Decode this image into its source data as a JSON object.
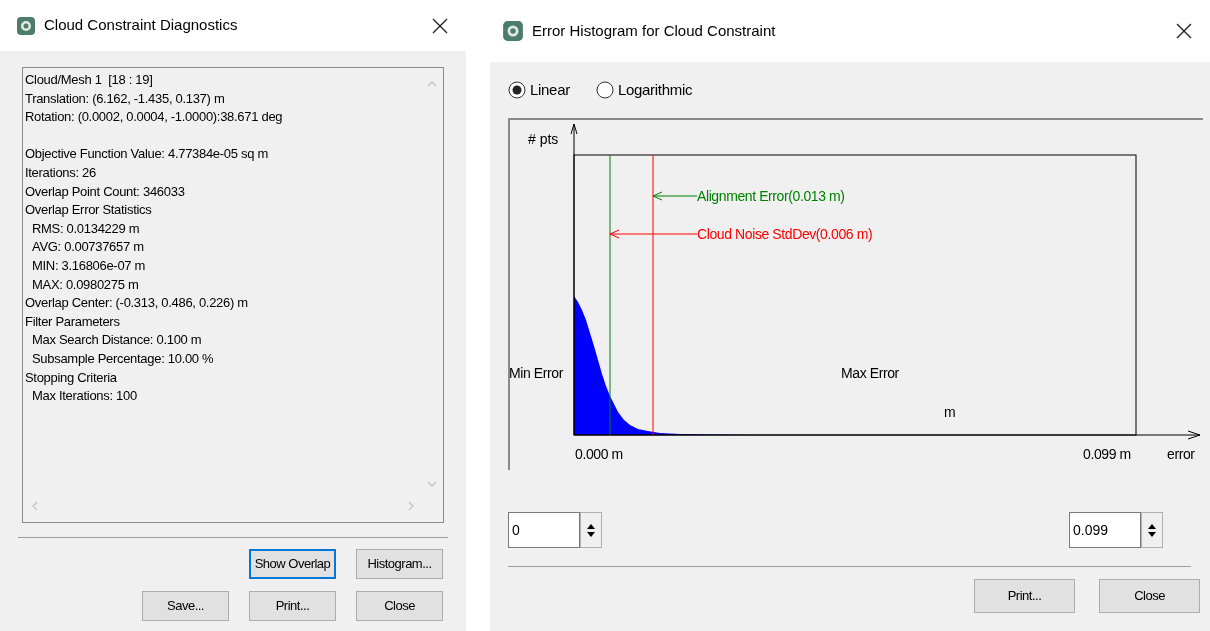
{
  "diagnostics_dialog": {
    "title": "Cloud Constraint Diagnostics",
    "report_lines": [
      {
        "text": "Cloud/Mesh 1  [18 : 19]",
        "indented": false
      },
      {
        "text": "Translation: (6.162, -1.435, 0.137) m",
        "indented": false
      },
      {
        "text": "Rotation: (0.0002, 0.0004, -1.0000):38.671 deg",
        "indented": false
      },
      {
        "text": "Objective Function Value: 4.77384e-05 sq m",
        "indented": false,
        "blank_line_before": true
      },
      {
        "text": "Iterations: 26",
        "indented": false
      },
      {
        "text": "Overlap Point Count: 346033",
        "indented": false
      },
      {
        "text": "Overlap Error Statistics",
        "indented": false
      },
      {
        "text": "RMS: 0.0134229 m",
        "indented": true
      },
      {
        "text": "AVG: 0.00737657 m",
        "indented": true
      },
      {
        "text": "MIN: 3.16806e-07 m",
        "indented": true
      },
      {
        "text": "MAX: 0.0980275 m",
        "indented": true
      },
      {
        "text": "Overlap Center: (-0.313, 0.486, 0.226) m",
        "indented": false
      },
      {
        "text": "Filter Parameters",
        "indented": false
      },
      {
        "text": "Max Search Distance: 0.100 m",
        "indented": true
      },
      {
        "text": "Subsample Percentage: 10.00 %",
        "indented": true
      },
      {
        "text": "Stopping Criteria",
        "indented": false
      },
      {
        "text": "Max Iterations: 100",
        "indented": true
      }
    ],
    "buttons": [
      {
        "label": "Show Overlap",
        "focused": true
      },
      {
        "label": "Histogram...",
        "focused": false
      },
      {
        "label": "Save...",
        "focused": false
      },
      {
        "label": "Print...",
        "focused": false
      },
      {
        "label": "Close",
        "focused": false
      }
    ]
  },
  "histogram_dialog": {
    "title": "Error Histogram for Cloud Constraint",
    "scale_options": [
      {
        "label": "Linear",
        "selected": true
      },
      {
        "label": "Logarithmic",
        "selected": false
      }
    ],
    "plot": {
      "ylabel": "# pts",
      "xlabel": "error",
      "min_label": "Min Error",
      "max_label": "Max Error",
      "unit_label": "m",
      "x_start": "0.000 m",
      "x_end": "0.099 m",
      "markers": [
        {
          "label": "Alignment Error(0.013 m)",
          "color": "#008000"
        },
        {
          "label": "Cloud Noise StdDev(0.006 m)",
          "color": "#ff0000"
        }
      ]
    },
    "min_value": "0",
    "max_value": "0.099",
    "buttons": [
      {
        "label": "Print...",
        "focused": false
      },
      {
        "label": "Close",
        "focused": false
      }
    ]
  }
}
